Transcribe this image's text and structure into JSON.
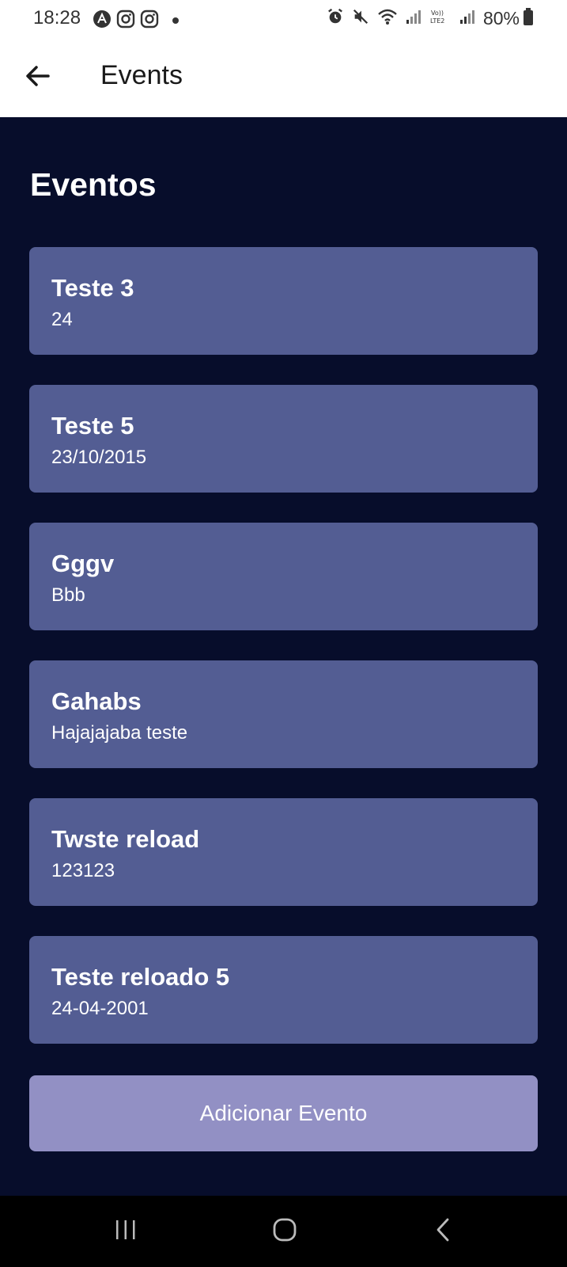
{
  "status_bar": {
    "time": "18:28",
    "battery": "80%",
    "left_icons": [
      "a-circle-icon",
      "instagram-icon",
      "instagram-icon",
      "dot-icon"
    ],
    "right_icons": [
      "alarm-icon",
      "mute-icon",
      "wifi-icon",
      "signal-icon",
      "volte-icon",
      "signal-icon",
      "battery-icon"
    ]
  },
  "app_bar": {
    "title": "Events",
    "back_icon": "arrow-left-icon"
  },
  "page": {
    "heading": "Eventos",
    "background_color": "#070d2b",
    "card_color": "#535d93",
    "button_color": "#9290c4"
  },
  "events": [
    {
      "title": "Teste 3",
      "subtitle": "24"
    },
    {
      "title": "Teste 5",
      "subtitle": "23/10/2015"
    },
    {
      "title": "Gggv",
      "subtitle": "Bbb"
    },
    {
      "title": "Gahabs",
      "subtitle": "Hajajajaba teste"
    },
    {
      "title": "Twste reload",
      "subtitle": "123123"
    },
    {
      "title": "Teste reloado 5",
      "subtitle": "24-04-2001"
    }
  ],
  "actions": {
    "add_event_label": "Adicionar Evento"
  },
  "nav_bar": {
    "icons": [
      "recent-apps-icon",
      "home-icon",
      "back-icon"
    ]
  }
}
